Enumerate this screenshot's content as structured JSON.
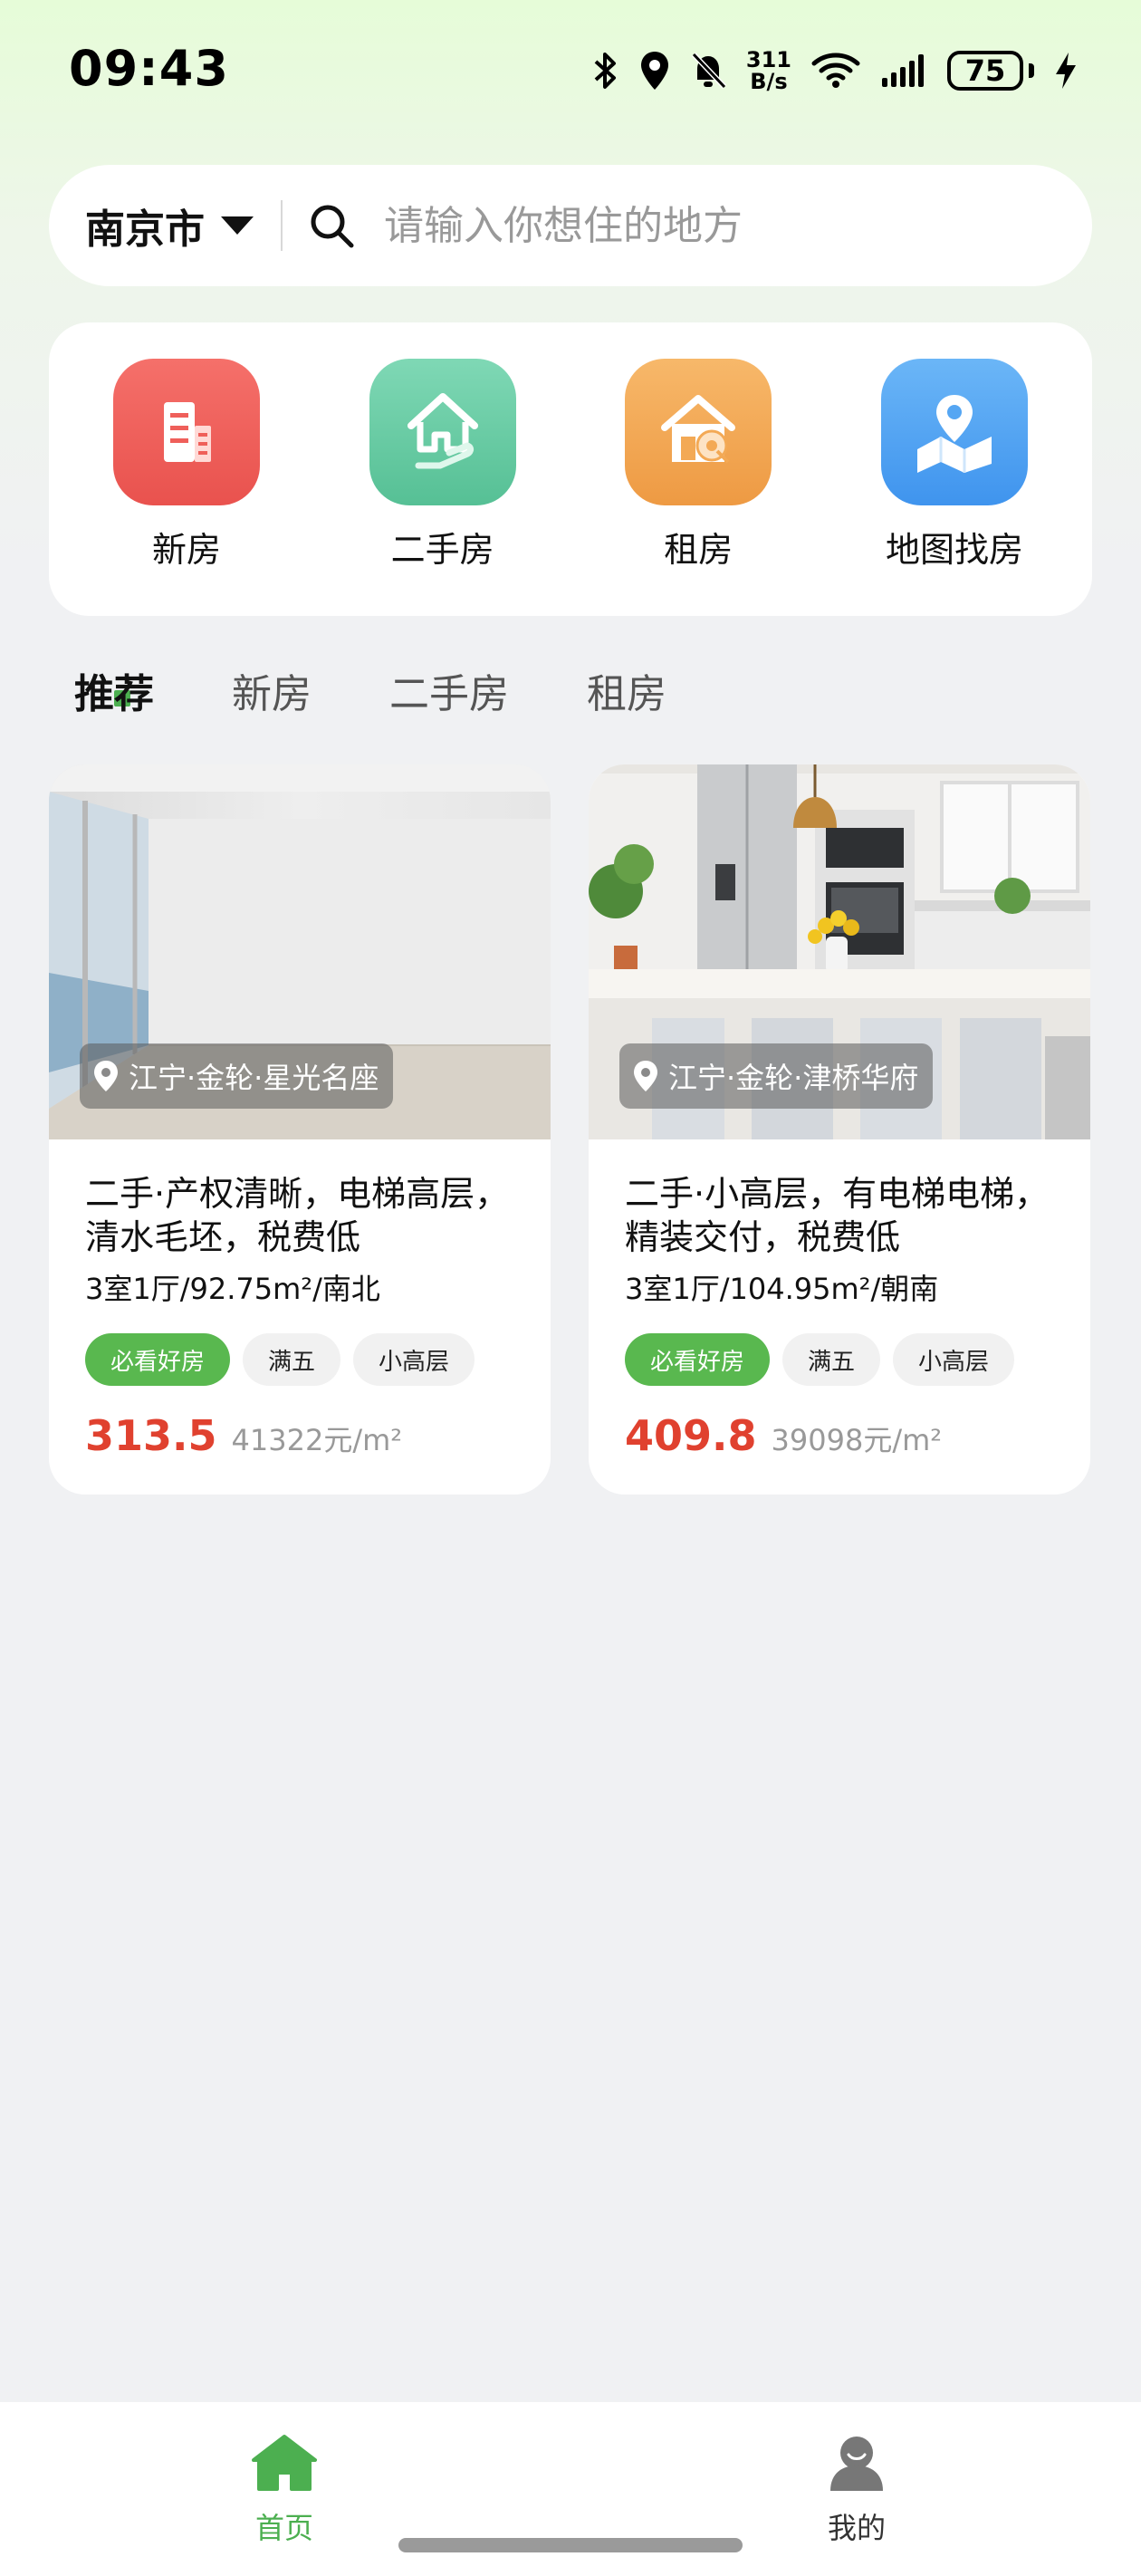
{
  "status_bar": {
    "time": "09:43",
    "net_speed_value": "311",
    "net_speed_unit": "B/s",
    "battery": "75",
    "icons": [
      "bluetooth-icon",
      "location-icon",
      "bell-off-icon",
      "wifi-icon",
      "signal-icon",
      "charging-icon"
    ]
  },
  "search": {
    "city": "南京市",
    "placeholder": "请输入你想住的地方"
  },
  "categories": [
    {
      "label": "新房",
      "icon": "building-icon",
      "color": "#ef5f5a"
    },
    {
      "label": "二手房",
      "icon": "house-hand-icon",
      "color": "#6bcda6"
    },
    {
      "label": "租房",
      "icon": "house-key-icon",
      "color": "#f3a955"
    },
    {
      "label": "地图找房",
      "icon": "map-pin-icon",
      "color": "#55a6f3"
    }
  ],
  "tabs": [
    "推荐",
    "新房",
    "二手房",
    "租房"
  ],
  "active_tab": "推荐",
  "listings": [
    {
      "location": "江宁·金轮·星光名座",
      "title": "二手·产权清晰，电梯高层，清水毛坯，税费低",
      "spec": "3室1厅/92.75m²/南北",
      "tags": [
        "必看好房",
        "满五",
        "小高层"
      ],
      "price": "313.5",
      "unit_price": "41322元/m²"
    },
    {
      "location": "江宁·金轮·津桥华府",
      "title": "二手·小高层，有电梯电梯，精装交付，税费低",
      "spec": "3室1厅/104.95m²/朝南",
      "tags": [
        "必看好房",
        "满五",
        "小高层"
      ],
      "price": "409.8",
      "unit_price": "39098元/m²"
    }
  ],
  "nav": {
    "home": "首页",
    "me": "我的"
  },
  "colors": {
    "accent_green": "#4caf50",
    "price_red": "#e0412f",
    "tag_green": "#59b84f"
  }
}
